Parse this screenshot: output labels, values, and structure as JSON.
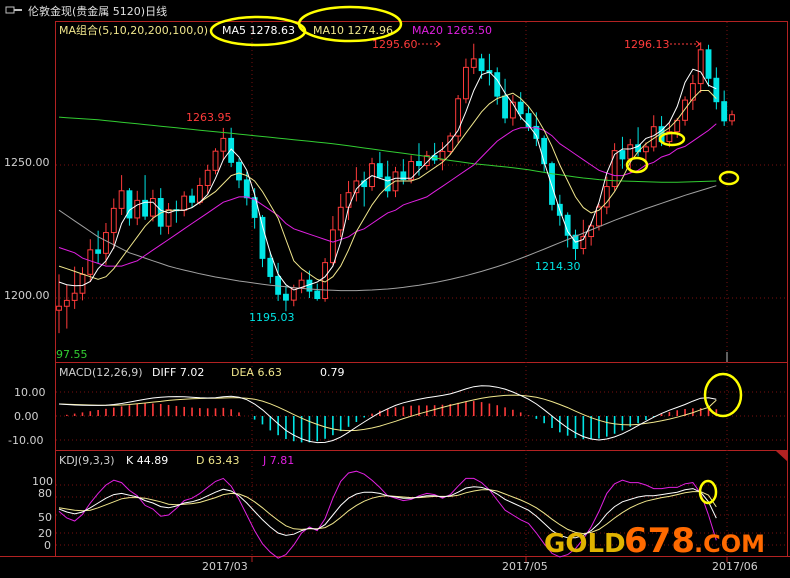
{
  "window": {
    "title": "伦敦金现(贵金属 5120)日线",
    "icon": "window-menu-icon"
  },
  "colors": {
    "bg": "#000000",
    "frame": "#b22222",
    "grid": "#7a1010",
    "up": "#ff3b3b",
    "down": "#00e5e5",
    "ma5": "#ffffff",
    "ma10": "#f0e68c",
    "ma20": "#e020e0",
    "ma100": "#32cd32",
    "ma200": "#a0a0a0",
    "label_price": "#ff3b3b",
    "label_low": "#00e5e5",
    "axis_text": "#d0d0d0",
    "annotation": "#ffff00",
    "watermark_gold": "#e0b400",
    "watermark_num": "#ff6a00"
  },
  "main_legend": {
    "group": "MA组合(5,10,20,200,100,0)",
    "ma5": "MA5 1278.63",
    "ma10": "MA10 1274.96",
    "ma20": "MA20 1265.50"
  },
  "price_axis": {
    "ticks": [
      "1250.00",
      "1200.00"
    ],
    "bottom_label": "97.55"
  },
  "annotations": {
    "high1": "1263.95",
    "low1": "1195.03",
    "high2": "1295.60",
    "low2": "1214.30",
    "high3": "1296.13"
  },
  "macd_panel": {
    "label": "MACD(12,26,9)",
    "diff": "DIFF  7.02",
    "dea": "DEA  6.63",
    "macd": "0.79",
    "ticks": [
      "10.00",
      "0.00",
      "-10.00"
    ]
  },
  "kdj_panel": {
    "label": "KDJ(9,3,3)",
    "k": "K  44.89",
    "d": "D  63.43",
    "j": "J  7.81",
    "ticks": [
      "100",
      "80",
      "50",
      "20",
      "0"
    ]
  },
  "date_axis": {
    "labels": [
      "2017/03",
      "2017/05",
      "2017/06"
    ]
  },
  "watermark": {
    "gold": "GOLD",
    "num": "678",
    "dotcom": ".COM"
  },
  "chart_data": {
    "type": "candlestick",
    "candles": [
      [
        1195.4,
        1208.9,
        1186.8,
        1196.9
      ],
      [
        1196.9,
        1205.0,
        1188.5,
        1199.1
      ],
      [
        1199.1,
        1211.8,
        1195.9,
        1201.8
      ],
      [
        1201.8,
        1211.6,
        1199.1,
        1208.9
      ],
      [
        1208.9,
        1222.1,
        1206.0,
        1218.1
      ],
      [
        1218.1,
        1225.3,
        1213.2,
        1216.8
      ],
      [
        1216.8,
        1228.2,
        1212.5,
        1224.6
      ],
      [
        1224.6,
        1237.4,
        1218.5,
        1233.7
      ],
      [
        1233.7,
        1246.2,
        1231.2,
        1240.3
      ],
      [
        1240.3,
        1241.3,
        1227.2,
        1230.1
      ],
      [
        1230.1,
        1240.3,
        1227.4,
        1236.7
      ],
      [
        1236.7,
        1246.2,
        1229.4,
        1230.8
      ],
      [
        1230.8,
        1240.7,
        1228.8,
        1237.4
      ],
      [
        1237.4,
        1241.3,
        1223.8,
        1227.0
      ],
      [
        1227.0,
        1235.7,
        1224.0,
        1233.2
      ],
      [
        1233.2,
        1236.6,
        1228.3,
        1233.0
      ],
      [
        1233.0,
        1240.1,
        1230.7,
        1238.3
      ],
      [
        1238.3,
        1241.1,
        1233.9,
        1236.0
      ],
      [
        1236.0,
        1245.2,
        1235.1,
        1242.3
      ],
      [
        1242.3,
        1250.1,
        1239.0,
        1248.0
      ],
      [
        1248.0,
        1256.3,
        1246.5,
        1255.2
      ],
      [
        1255.2,
        1263.95,
        1251.7,
        1260.0
      ],
      [
        1260.0,
        1264.0,
        1249.2,
        1251.0
      ],
      [
        1251.0,
        1252.5,
        1241.3,
        1244.4
      ],
      [
        1244.4,
        1247.5,
        1234.8,
        1237.7
      ],
      [
        1237.7,
        1241.3,
        1226.1,
        1230.3
      ],
      [
        1230.3,
        1231.2,
        1211.6,
        1214.9
      ],
      [
        1214.9,
        1217.5,
        1205.5,
        1208.1
      ],
      [
        1208.1,
        1213.2,
        1198.9,
        1201.4
      ],
      [
        1201.4,
        1204.6,
        1195.03,
        1199.2
      ],
      [
        1199.2,
        1205.0,
        1196.9,
        1203.8
      ],
      [
        1203.8,
        1209.6,
        1201.8,
        1206.7
      ],
      [
        1206.7,
        1210.3,
        1200.0,
        1202.6
      ],
      [
        1202.6,
        1205.4,
        1199.0,
        1199.8
      ],
      [
        1199.8,
        1215.0,
        1198.6,
        1213.3
      ],
      [
        1213.3,
        1230.8,
        1212.1,
        1225.6
      ],
      [
        1225.6,
        1239.1,
        1222.9,
        1234.1
      ],
      [
        1234.1,
        1244.0,
        1229.3,
        1239.6
      ],
      [
        1239.6,
        1249.2,
        1236.3,
        1244.0
      ],
      [
        1244.0,
        1247.5,
        1234.4,
        1241.9
      ],
      [
        1241.9,
        1252.7,
        1240.3,
        1250.5
      ],
      [
        1250.5,
        1254.9,
        1244.7,
        1245.5
      ],
      [
        1245.5,
        1251.6,
        1237.8,
        1240.3
      ],
      [
        1240.3,
        1249.3,
        1237.9,
        1247.4
      ],
      [
        1247.4,
        1252.2,
        1242.7,
        1244.5
      ],
      [
        1244.5,
        1253.6,
        1243.1,
        1251.3
      ],
      [
        1251.3,
        1258.2,
        1246.0,
        1249.8
      ],
      [
        1249.8,
        1255.3,
        1248.2,
        1253.5
      ],
      [
        1253.5,
        1258.3,
        1250.4,
        1251.9
      ],
      [
        1251.9,
        1258.6,
        1248.0,
        1255.1
      ],
      [
        1255.1,
        1262.2,
        1253.9,
        1260.9
      ],
      [
        1260.9,
        1276.3,
        1258.3,
        1274.9
      ],
      [
        1274.9,
        1290.0,
        1273.2,
        1286.7
      ],
      [
        1286.7,
        1295.6,
        1284.2,
        1289.9
      ],
      [
        1289.9,
        1291.8,
        1282.4,
        1285.5
      ],
      [
        1285.5,
        1291.8,
        1279.9,
        1284.7
      ],
      [
        1284.7,
        1286.7,
        1272.7,
        1275.9
      ],
      [
        1275.9,
        1282.4,
        1265.7,
        1267.7
      ],
      [
        1267.7,
        1276.3,
        1264.8,
        1273.6
      ],
      [
        1273.6,
        1277.4,
        1266.9,
        1269.3
      ],
      [
        1269.3,
        1272.0,
        1262.8,
        1264.5
      ],
      [
        1264.5,
        1269.8,
        1257.1,
        1260.0
      ],
      [
        1260.0,
        1261.1,
        1247.5,
        1250.5
      ],
      [
        1250.5,
        1251.3,
        1232.9,
        1235.2
      ],
      [
        1235.2,
        1238.8,
        1227.2,
        1231.1
      ],
      [
        1231.1,
        1232.2,
        1219.0,
        1223.6
      ],
      [
        1223.6,
        1225.7,
        1214.3,
        1218.6
      ],
      [
        1218.6,
        1229.4,
        1216.4,
        1223.1
      ],
      [
        1223.1,
        1228.7,
        1219.7,
        1227.1
      ],
      [
        1227.1,
        1235.4,
        1225.4,
        1234.2
      ],
      [
        1234.2,
        1245.6,
        1231.5,
        1241.9
      ],
      [
        1241.9,
        1258.2,
        1240.3,
        1255.4
      ],
      [
        1255.4,
        1260.6,
        1248.6,
        1252.3
      ],
      [
        1252.3,
        1259.8,
        1247.2,
        1257.6
      ],
      [
        1257.6,
        1264.2,
        1253.3,
        1255.0
      ],
      [
        1255.0,
        1258.5,
        1251.2,
        1256.8
      ],
      [
        1256.8,
        1268.7,
        1255.1,
        1264.4
      ],
      [
        1264.4,
        1268.4,
        1257.1,
        1258.8
      ],
      [
        1258.8,
        1265.7,
        1256.7,
        1262.5
      ],
      [
        1262.5,
        1267.7,
        1260.2,
        1266.8
      ],
      [
        1266.8,
        1275.8,
        1264.8,
        1274.4
      ],
      [
        1274.4,
        1283.9,
        1270.7,
        1280.6
      ],
      [
        1280.6,
        1296.13,
        1277.2,
        1293.3
      ],
      [
        1293.3,
        1295.2,
        1279.5,
        1282.6
      ],
      [
        1282.6,
        1286.7,
        1270.9,
        1273.8
      ],
      [
        1273.8,
        1278.0,
        1264.7,
        1266.6
      ],
      [
        1266.6,
        1270.5,
        1264.9,
        1268.9
      ]
    ],
    "ma5": [
      1206,
      1205,
      1204.6,
      1204.7,
      1206.2,
      1211,
      1214,
      1219,
      1228,
      1233,
      1235,
      1236,
      1236,
      1233,
      1232,
      1233,
      1233,
      1234,
      1236,
      1239,
      1245,
      1252,
      1256,
      1253,
      1248,
      1239,
      1227,
      1217,
      1209,
      1205,
      1203,
      1204,
      1205,
      1206,
      1208,
      1212,
      1221,
      1234,
      1241,
      1244,
      1246,
      1245,
      1244,
      1245,
      1245,
      1245,
      1248,
      1251,
      1254,
      1256,
      1259,
      1263,
      1270,
      1278,
      1284,
      1285,
      1282,
      1277,
      1273,
      1268,
      1265,
      1261,
      1251,
      1242,
      1233,
      1225,
      1221,
      1222,
      1228,
      1236,
      1247,
      1254,
      1256,
      1256,
      1257,
      1260,
      1261,
      1263,
      1266,
      1272,
      1281,
      1286,
      1285,
      1280,
      1278.63
    ],
    "ma10": [
      1212,
      1211,
      1210,
      1209,
      1208,
      1207,
      1208,
      1211,
      1215,
      1219,
      1223,
      1227,
      1230,
      1232,
      1233,
      1233,
      1233,
      1234,
      1236,
      1238,
      1240,
      1243,
      1246,
      1247,
      1246,
      1244,
      1240,
      1235,
      1230,
      1222,
      1214,
      1211,
      1209,
      1207,
      1206,
      1208,
      1212,
      1218,
      1225,
      1230,
      1235,
      1239,
      1242,
      1244,
      1244,
      1244,
      1245,
      1247,
      1249,
      1251,
      1254,
      1258,
      1262,
      1266,
      1270,
      1273,
      1275,
      1276,
      1277,
      1275,
      1272,
      1268,
      1263,
      1257,
      1250,
      1244,
      1238,
      1234,
      1232,
      1233,
      1236,
      1240,
      1245,
      1251,
      1255,
      1258,
      1260,
      1262,
      1264,
      1267,
      1271,
      1275,
      1278,
      1278,
      1274.96
    ],
    "ma20": [
      1219,
      1218,
      1217,
      1215,
      1214,
      1213,
      1212,
      1212,
      1212,
      1213,
      1214,
      1216,
      1218,
      1220,
      1222,
      1224,
      1226,
      1228,
      1230,
      1232,
      1234,
      1236,
      1237,
      1238,
      1238,
      1237,
      1235,
      1233,
      1231,
      1228,
      1226,
      1225,
      1224,
      1223,
      1222,
      1221,
      1222,
      1223,
      1225,
      1226,
      1228,
      1230,
      1232,
      1233,
      1235,
      1236,
      1237,
      1238,
      1240,
      1242,
      1244,
      1246,
      1248,
      1250,
      1253,
      1256,
      1259,
      1261,
      1263,
      1264,
      1264,
      1264,
      1263,
      1261,
      1258,
      1256,
      1254,
      1252,
      1250,
      1248,
      1247,
      1246,
      1246,
      1247,
      1248,
      1250,
      1251,
      1253,
      1254,
      1256,
      1257,
      1259,
      1261,
      1263,
      1265.5
    ],
    "ma100": [
      1268,
      1267.8,
      1267.6,
      1267.4,
      1267.2,
      1267,
      1266.7,
      1266.4,
      1266.1,
      1265.8,
      1265.5,
      1265.2,
      1264.9,
      1264.6,
      1264.3,
      1264,
      1263.7,
      1263.4,
      1263.1,
      1262.8,
      1262.5,
      1262.2,
      1261.9,
      1261.6,
      1261.3,
      1261,
      1260.7,
      1260.4,
      1260.1,
      1259.8,
      1259.5,
      1259.2,
      1258.9,
      1258.6,
      1258.3,
      1258,
      1257.6,
      1257.2,
      1256.8,
      1256.4,
      1256,
      1255.6,
      1255.2,
      1254.8,
      1254.4,
      1254,
      1253.6,
      1253.2,
      1252.7,
      1252.2,
      1251.7,
      1251.3,
      1250.9,
      1250.5,
      1250.2,
      1249.9,
      1249.6,
      1249.3,
      1249,
      1248.6,
      1248.2,
      1247.7,
      1247.2,
      1246.7,
      1246.3,
      1245.9,
      1245.5,
      1245.1,
      1244.8,
      1244.5,
      1244.3,
      1244.1,
      1244,
      1243.9,
      1243.8,
      1243.7,
      1243.6,
      1243.5,
      1243.5,
      1243.5,
      1243.6,
      1243.7,
      1243.8,
      1243.9,
      1244
    ],
    "ma200": [
      1233,
      1231,
      1229,
      1227,
      1225,
      1223,
      1221.5,
      1220,
      1218.5,
      1217,
      1216,
      1215,
      1214,
      1213,
      1212,
      1211.2,
      1210.5,
      1209.8,
      1209.1,
      1208.5,
      1207.9,
      1207.4,
      1206.9,
      1206.4,
      1206,
      1205.6,
      1205.2,
      1204.8,
      1204.5,
      1204.2,
      1203.9,
      1203.6,
      1203.4,
      1203.2,
      1203,
      1202.9,
      1202.8,
      1202.8,
      1202.8,
      1202.9,
      1203,
      1203.2,
      1203.4,
      1203.7,
      1204,
      1204.4,
      1204.8,
      1205.3,
      1205.8,
      1206.4,
      1207,
      1207.7,
      1208.4,
      1209.2,
      1210,
      1210.9,
      1211.8,
      1212.8,
      1213.8,
      1214.9,
      1216,
      1217.2,
      1218.4,
      1219.6,
      1220.8,
      1222,
      1223.2,
      1224.4,
      1225.6,
      1226.8,
      1228,
      1229.2,
      1230.3,
      1231.4,
      1232.5,
      1233.6,
      1234.6,
      1235.6,
      1236.6,
      1237.6,
      1238.6,
      1239.5,
      1240.4,
      1241.3,
      1242.2
    ],
    "macd_hist": [
      0,
      0.5,
      1,
      1.5,
      2,
      2.5,
      3,
      3.5,
      4,
      4.5,
      5,
      5.5,
      5.2,
      5,
      4.6,
      4.2,
      3.8,
      3.5,
      3.3,
      3.2,
      3.2,
      3.4,
      2.8,
      1.5,
      0,
      -1.5,
      -3.5,
      -6,
      -8,
      -9.6,
      -10.5,
      -11,
      -11,
      -10.5,
      -9.5,
      -8,
      -6.3,
      -4.5,
      -2.5,
      -0.6,
      1,
      2.2,
      3,
      3.6,
      4,
      4.3,
      4.4,
      4.4,
      4.5,
      4.7,
      5,
      5.5,
      6,
      6.2,
      5.8,
      5.2,
      4.5,
      3.6,
      2.6,
      1.5,
      0.3,
      -1.2,
      -3,
      -5,
      -6.8,
      -8.2,
      -9.2,
      -9.7,
      -9.8,
      -9.4,
      -8.6,
      -7.4,
      -6,
      -4.5,
      -3,
      -1.7,
      -0.4,
      0.8,
      1.7,
      2.4,
      2.9,
      3.2,
      3.3,
      3.2,
      2.8
    ],
    "macd_diff": [
      5,
      4.8,
      4.6,
      4.5,
      4.4,
      4.4,
      4.5,
      4.8,
      5.2,
      5.8,
      6.4,
      7,
      7.5,
      7.8,
      8,
      8.1,
      8,
      7.8,
      7.6,
      7.5,
      7.6,
      8,
      8.2,
      7.8,
      6.8,
      5,
      2.6,
      -0.3,
      -3.2,
      -6,
      -8,
      -9.5,
      -10.6,
      -11.1,
      -11,
      -10.2,
      -8.8,
      -6.8,
      -4.6,
      -2.5,
      -0.5,
      1.4,
      3,
      4.4,
      5.5,
      6.3,
      7,
      7.6,
      8.1,
      8.6,
      9.2,
      10.2,
      11.3,
      12.2,
      12.6,
      12.5,
      12,
      11.2,
      10,
      8.6,
      7,
      5,
      2.6,
      0,
      -2.6,
      -5,
      -7,
      -8.6,
      -9.6,
      -10,
      -9.6,
      -8.7,
      -7.4,
      -5.8,
      -4,
      -2.2,
      -0.5,
      1.1,
      2.4,
      3.6,
      4.8,
      6.2,
      7.4,
      7.6,
      7.02
    ],
    "macd_dea": [
      5,
      4.9,
      4.8,
      4.7,
      4.6,
      4.5,
      4.5,
      4.5,
      4.6,
      4.8,
      5.1,
      5.4,
      5.8,
      6.1,
      6.5,
      6.8,
      7,
      7.2,
      7.3,
      7.4,
      7.4,
      7.5,
      7.6,
      7.6,
      7.4,
      7,
      6.2,
      5.1,
      3.7,
      2.2,
      0.6,
      -0.9,
      -2.3,
      -3.5,
      -4.6,
      -5.4,
      -5.9,
      -6.1,
      -6,
      -5.6,
      -5,
      -4.2,
      -3.2,
      -2.2,
      -1.1,
      -0.1,
      0.9,
      1.8,
      2.7,
      3.6,
      4.4,
      5.2,
      6,
      6.7,
      7.4,
      7.9,
      8.3,
      8.6,
      8.7,
      8.6,
      8.3,
      7.8,
      7,
      6,
      4.8,
      3.5,
      2,
      0.6,
      -0.7,
      -1.8,
      -2.7,
      -3.3,
      -3.6,
      -3.7,
      -3.5,
      -3.1,
      -2.6,
      -2,
      -1.3,
      -0.5,
      0.4,
      1.4,
      2.6,
      3.6,
      6.63
    ],
    "kdj_k": [
      60,
      55,
      52,
      55,
      62,
      70,
      78,
      84,
      86,
      83,
      80,
      74,
      70,
      64,
      62,
      65,
      70,
      72,
      76,
      82,
      88,
      93,
      90,
      82,
      70,
      56,
      42,
      30,
      20,
      16,
      18,
      24,
      28,
      26,
      34,
      50,
      66,
      78,
      85,
      88,
      88,
      86,
      82,
      80,
      78,
      78,
      80,
      82,
      82,
      80,
      82,
      88,
      95,
      97,
      96,
      92,
      85,
      76,
      70,
      64,
      58,
      48,
      36,
      24,
      16,
      12,
      12,
      16,
      24,
      36,
      52,
      64,
      72,
      76,
      80,
      82,
      82,
      84,
      86,
      88,
      92,
      94,
      88,
      72,
      44.89
    ],
    "kdj_d": [
      62,
      60,
      58,
      57,
      58,
      62,
      67,
      72,
      77,
      79,
      79,
      78,
      75,
      72,
      68,
      67,
      68,
      69,
      71,
      75,
      79,
      84,
      86,
      85,
      80,
      72,
      62,
      51,
      41,
      32,
      27,
      26,
      27,
      27,
      29,
      36,
      46,
      57,
      66,
      73,
      78,
      81,
      82,
      81,
      80,
      79,
      79,
      80,
      81,
      81,
      81,
      83,
      87,
      90,
      92,
      92,
      90,
      85,
      80,
      75,
      69,
      62,
      53,
      43,
      34,
      26,
      21,
      19,
      21,
      26,
      35,
      45,
      54,
      62,
      68,
      73,
      76,
      79,
      81,
      84,
      87,
      89,
      89,
      83,
      63.43
    ],
    "kdj_j": [
      56,
      45,
      40,
      51,
      70,
      86,
      100,
      108,
      104,
      91,
      82,
      66,
      60,
      48,
      50,
      61,
      74,
      78,
      86,
      96,
      106,
      111,
      98,
      76,
      50,
      24,
      2,
      -12,
      -22,
      -16,
      0,
      20,
      30,
      24,
      44,
      78,
      106,
      120,
      123,
      118,
      108,
      96,
      82,
      78,
      74,
      76,
      82,
      86,
      84,
      78,
      84,
      98,
      111,
      111,
      104,
      92,
      75,
      58,
      50,
      42,
      36,
      20,
      2,
      -14,
      -20,
      -16,
      -6,
      10,
      30,
      56,
      86,
      102,
      108,
      104,
      104,
      100,
      94,
      94,
      96,
      96,
      102,
      104,
      86,
      50,
      7.81
    ]
  }
}
